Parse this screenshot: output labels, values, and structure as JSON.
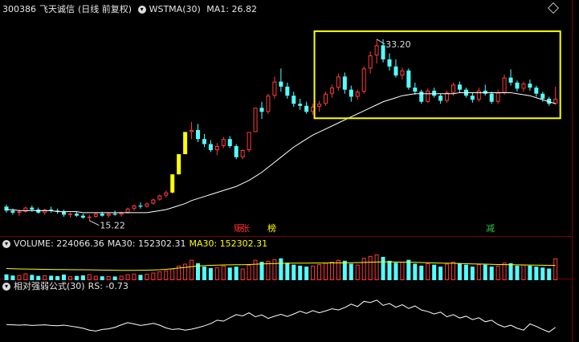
{
  "main": {
    "code": "300386",
    "name": "飞天诚信",
    "period": "(日线 前复权)",
    "indicator": "WSTMA(30)",
    "ma_label": "MA1: 26.82",
    "high_label": "33.20",
    "low_label": "15.22"
  },
  "tags": [
    {
      "text": "赈",
      "color": "#ff3030"
    },
    {
      "text": "张",
      "color": "#ff3030"
    },
    {
      "text": "榜",
      "color": "#ffff00"
    },
    {
      "text": "减",
      "color": "#2ecc40"
    }
  ],
  "volume": {
    "title": "VOLUME: 224066.36",
    "ma_a": "MA30: 152302.31",
    "ma_b": "MA30: 152302.31"
  },
  "rs": {
    "title": "相对强弱公式(30)",
    "value": "RS: -0.73"
  },
  "colors": {
    "up": "#ff3b3b",
    "down": "#54ffff",
    "limit": "#ffff00",
    "highlight_box": "#ffff00",
    "ma": "#ffffff"
  },
  "chart_data": {
    "type": "candlestick",
    "ohlc": [
      [
        16.6,
        16.8,
        16.0,
        16.2
      ],
      [
        16.2,
        16.4,
        15.8,
        16.0
      ],
      [
        16.0,
        16.3,
        15.7,
        16.1
      ],
      [
        16.1,
        16.6,
        16.0,
        16.5
      ],
      [
        16.5,
        16.7,
        16.1,
        16.3
      ],
      [
        16.3,
        16.5,
        15.9,
        16.0
      ],
      [
        16.0,
        16.4,
        15.8,
        16.3
      ],
      [
        16.3,
        16.6,
        16.0,
        16.2
      ],
      [
        16.2,
        16.4,
        15.9,
        16.1
      ],
      [
        16.1,
        16.3,
        15.6,
        15.8
      ],
      [
        15.8,
        16.0,
        15.5,
        15.9
      ],
      [
        15.9,
        16.1,
        15.6,
        15.7
      ],
      [
        15.7,
        15.9,
        15.4,
        15.5
      ],
      [
        15.5,
        15.8,
        15.22,
        15.6
      ],
      [
        15.6,
        16.0,
        15.5,
        15.9
      ],
      [
        15.9,
        16.1,
        15.6,
        15.7
      ],
      [
        15.7,
        16.0,
        15.5,
        15.9
      ],
      [
        15.9,
        16.2,
        15.7,
        15.8
      ],
      [
        15.8,
        16.1,
        15.6,
        16.0
      ],
      [
        16.0,
        16.5,
        15.9,
        16.4
      ],
      [
        16.4,
        16.8,
        16.2,
        16.7
      ],
      [
        16.7,
        17.0,
        16.4,
        16.6
      ],
      [
        16.6,
        17.0,
        16.5,
        16.9
      ],
      [
        16.9,
        17.4,
        16.8,
        17.3
      ],
      [
        17.3,
        17.8,
        17.2,
        17.7
      ],
      [
        17.7,
        18.2,
        17.5,
        18.0
      ],
      [
        18.0,
        19.8,
        17.9,
        19.8
      ],
      [
        19.8,
        21.8,
        19.8,
        21.8
      ],
      [
        21.8,
        24.0,
        21.8,
        24.0
      ],
      [
        24.0,
        25.0,
        23.3,
        24.2
      ],
      [
        24.2,
        24.8,
        23.0,
        23.3
      ],
      [
        23.3,
        23.8,
        22.5,
        22.8
      ],
      [
        22.8,
        23.2,
        22.0,
        22.2
      ],
      [
        22.2,
        22.9,
        21.7,
        22.6
      ],
      [
        22.6,
        23.5,
        22.4,
        23.3
      ],
      [
        23.3,
        23.6,
        22.4,
        22.6
      ],
      [
        22.6,
        22.8,
        21.3,
        21.5
      ],
      [
        21.5,
        22.3,
        21.3,
        22.2
      ],
      [
        22.2,
        24.0,
        22.0,
        24.0
      ],
      [
        24.0,
        26.4,
        24.0,
        26.4
      ],
      [
        26.4,
        27.0,
        25.3,
        26.0
      ],
      [
        26.0,
        27.8,
        25.8,
        27.6
      ],
      [
        27.6,
        29.5,
        27.3,
        29.0
      ],
      [
        29.0,
        30.3,
        28.0,
        28.5
      ],
      [
        28.5,
        28.9,
        27.3,
        27.6
      ],
      [
        27.6,
        28.0,
        26.5,
        26.8
      ],
      [
        26.8,
        27.3,
        26.2,
        26.6
      ],
      [
        26.6,
        27.0,
        25.8,
        26.0
      ],
      [
        26.0,
        26.8,
        25.7,
        26.5
      ],
      [
        26.5,
        27.1,
        26.0,
        26.8
      ],
      [
        26.8,
        28.0,
        26.6,
        27.8
      ],
      [
        27.8,
        28.7,
        27.4,
        28.4
      ],
      [
        28.4,
        29.8,
        28.1,
        29.5
      ],
      [
        29.5,
        29.9,
        27.8,
        28.2
      ],
      [
        28.2,
        28.6,
        27.0,
        27.5
      ],
      [
        27.5,
        28.2,
        27.2,
        28.0
      ],
      [
        28.0,
        30.5,
        27.8,
        30.3
      ],
      [
        30.3,
        32.0,
        29.8,
        31.6
      ],
      [
        31.6,
        33.2,
        30.8,
        32.6
      ],
      [
        32.6,
        33.2,
        30.9,
        31.2
      ],
      [
        31.2,
        31.8,
        30.1,
        30.5
      ],
      [
        30.5,
        31.2,
        29.4,
        29.6
      ],
      [
        29.6,
        30.4,
        29.2,
        30.1
      ],
      [
        30.1,
        30.3,
        28.2,
        28.4
      ],
      [
        28.4,
        28.9,
        27.7,
        28.0
      ],
      [
        28.0,
        28.2,
        26.8,
        27.0
      ],
      [
        27.0,
        28.3,
        26.9,
        28.1
      ],
      [
        28.1,
        28.4,
        27.4,
        27.6
      ],
      [
        27.6,
        27.8,
        26.8,
        27.1
      ],
      [
        27.1,
        28.1,
        26.9,
        27.9
      ],
      [
        27.9,
        28.9,
        27.6,
        28.7
      ],
      [
        28.7,
        29.0,
        27.9,
        28.2
      ],
      [
        28.2,
        28.4,
        27.4,
        27.6
      ],
      [
        27.6,
        27.9,
        26.9,
        27.2
      ],
      [
        27.2,
        28.4,
        27.0,
        28.1
      ],
      [
        28.1,
        28.7,
        27.6,
        27.8
      ],
      [
        27.8,
        28.0,
        26.8,
        27.0
      ],
      [
        27.0,
        28.2,
        26.8,
        27.9
      ],
      [
        27.9,
        29.7,
        27.7,
        29.4
      ],
      [
        29.4,
        30.2,
        28.6,
        28.9
      ],
      [
        28.9,
        29.1,
        28.0,
        28.3
      ],
      [
        28.3,
        29.0,
        28.0,
        28.8
      ],
      [
        28.8,
        29.2,
        28.1,
        28.4
      ],
      [
        28.4,
        28.6,
        27.5,
        27.8
      ],
      [
        27.8,
        28.0,
        27.0,
        27.3
      ],
      [
        27.3,
        27.5,
        26.6,
        26.8
      ],
      [
        26.8,
        28.5,
        26.7,
        27.3
      ]
    ],
    "ma30": [
      16.3,
      16.3,
      16.2,
      16.2,
      16.2,
      16.2,
      16.2,
      16.2,
      16.1,
      16.1,
      16.1,
      16.1,
      16.0,
      16.0,
      16.0,
      16.0,
      16.0,
      16.0,
      16.0,
      16.0,
      16.0,
      16.0,
      16.0,
      16.1,
      16.2,
      16.3,
      16.5,
      16.7,
      16.9,
      17.2,
      17.4,
      17.6,
      17.8,
      18.0,
      18.2,
      18.4,
      18.6,
      18.9,
      19.2,
      19.6,
      20.0,
      20.5,
      21.0,
      21.5,
      22.0,
      22.5,
      22.9,
      23.3,
      23.7,
      24.0,
      24.3,
      24.6,
      24.9,
      25.2,
      25.5,
      25.8,
      26.1,
      26.4,
      26.7,
      27.0,
      27.2,
      27.4,
      27.6,
      27.7,
      27.8,
      27.8,
      27.8,
      27.8,
      27.8,
      27.8,
      27.8,
      27.9,
      27.9,
      27.9,
      27.9,
      27.9,
      27.9,
      27.9,
      27.9,
      27.9,
      27.8,
      27.7,
      27.6,
      27.4,
      27.2,
      27.0,
      26.82
    ],
    "volume": [
      60,
      48,
      52,
      70,
      55,
      44,
      50,
      46,
      42,
      58,
      40,
      44,
      50,
      62,
      45,
      40,
      42,
      38,
      46,
      60,
      68,
      55,
      66,
      78,
      90,
      100,
      120,
      150,
      170,
      210,
      175,
      140,
      125,
      132,
      150,
      130,
      140,
      120,
      160,
      210,
      190,
      200,
      215,
      225,
      180,
      160,
      150,
      140,
      150,
      165,
      180,
      190,
      210,
      200,
      170,
      160,
      230,
      250,
      265,
      240,
      200,
      180,
      190,
      210,
      170,
      150,
      175,
      160,
      140,
      170,
      190,
      175,
      160,
      140,
      165,
      160,
      140,
      150,
      180,
      175,
      150,
      160,
      150,
      140,
      130,
      120,
      224
    ],
    "vol_ma30": [
      120,
      118,
      116,
      115,
      114,
      113,
      112,
      111,
      110,
      110,
      109,
      108,
      108,
      107,
      106,
      105,
      104,
      103,
      102,
      102,
      102,
      103,
      104,
      106,
      108,
      112,
      118,
      125,
      132,
      140,
      146,
      150,
      153,
      155,
      157,
      158,
      159,
      160,
      162,
      165,
      168,
      170,
      172,
      174,
      175,
      176,
      176,
      176,
      177,
      177,
      177,
      178,
      178,
      179,
      180,
      181,
      183,
      185,
      187,
      188,
      188,
      187,
      186,
      185,
      184,
      182,
      180,
      178,
      176,
      175,
      174,
      172,
      170,
      168,
      167,
      166,
      164,
      162,
      161,
      160,
      158,
      157,
      156,
      155,
      154,
      153,
      152.3
    ],
    "rs": [
      6,
      5,
      4,
      5,
      3,
      4,
      5,
      3,
      2,
      4,
      1,
      -2,
      -6,
      -12,
      -15,
      -10,
      -8,
      -3,
      5,
      12,
      8,
      3,
      6,
      10,
      4,
      -5,
      -10,
      -8,
      -12,
      -9,
      -4,
      2,
      9,
      20,
      17,
      28,
      38,
      34,
      44,
      31,
      37,
      26,
      33,
      39,
      32,
      40,
      49,
      42,
      51,
      44,
      50,
      57,
      53,
      61,
      72,
      64,
      81,
      77,
      85,
      68,
      74,
      62,
      70,
      58,
      66,
      53,
      48,
      40,
      46,
      31,
      38,
      27,
      33,
      22,
      28,
      15,
      20,
      6,
      -2,
      4,
      -6,
      -12,
      8,
      0,
      -10,
      -18,
      -3
    ],
    "price_range": [
      14.0,
      35.5
    ],
    "volume_range": [
      0,
      290
    ],
    "rs_range": [
      -40,
      100
    ]
  }
}
